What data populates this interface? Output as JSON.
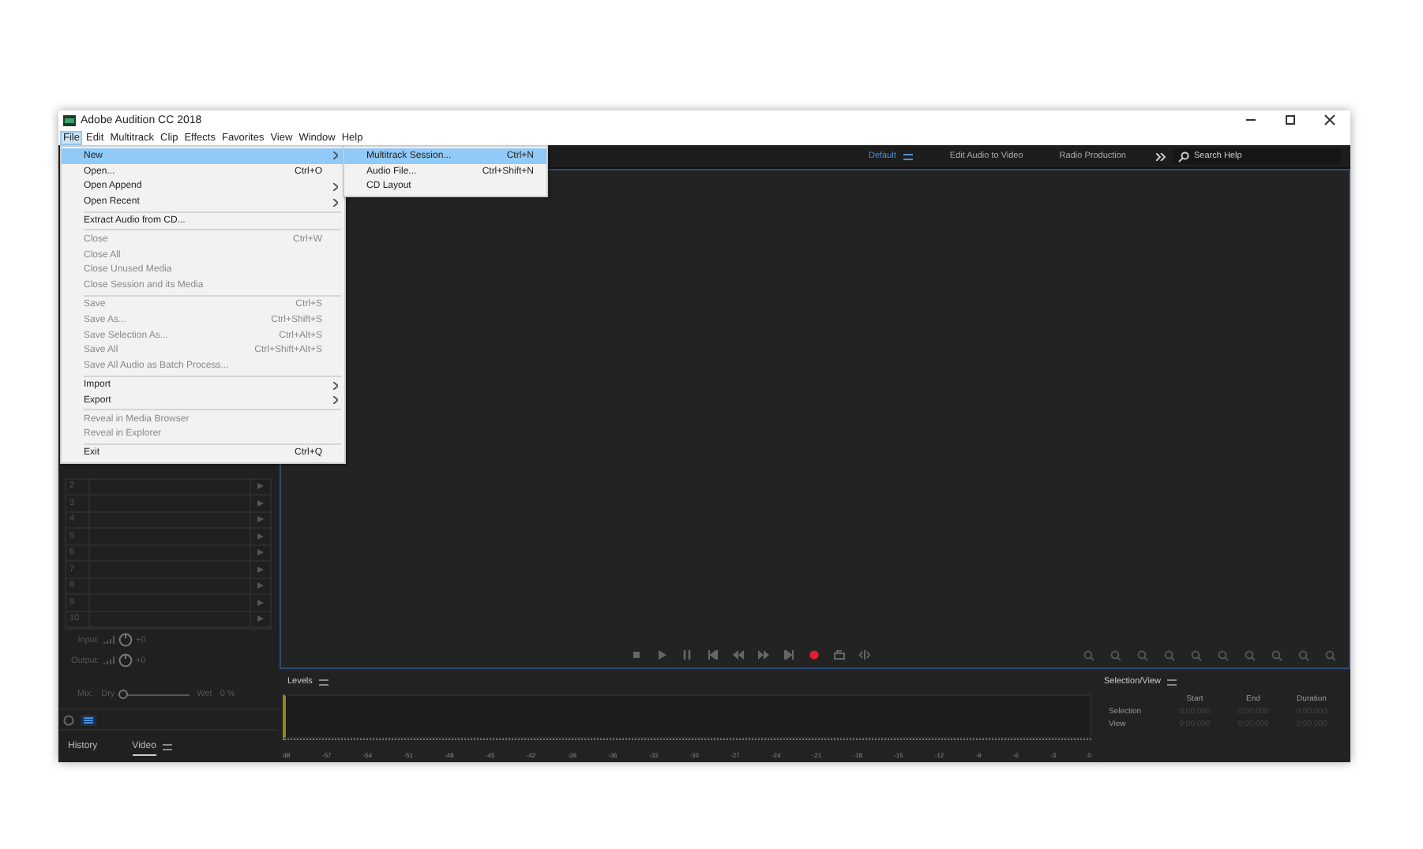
{
  "window": {
    "title": "Adobe Audition CC 2018"
  },
  "menubar": [
    {
      "label": "File",
      "selected": true
    },
    {
      "label": "Edit",
      "selected": false
    },
    {
      "label": "Multitrack",
      "selected": false
    },
    {
      "label": "Clip",
      "selected": false
    },
    {
      "label": "Effects",
      "selected": false
    },
    {
      "label": "Favorites",
      "selected": false
    },
    {
      "label": "View",
      "selected": false
    },
    {
      "label": "Window",
      "selected": false
    },
    {
      "label": "Help",
      "selected": false
    }
  ],
  "file_menu": [
    [
      {
        "label": "New",
        "submenu": true,
        "disabled": false,
        "selected": true
      },
      {
        "label": "Open...",
        "shortcut": "Ctrl+O",
        "submenu": false,
        "disabled": false,
        "selected": false
      },
      {
        "label": "Open Append",
        "submenu": true,
        "disabled": false,
        "selected": false
      },
      {
        "label": "Open Recent",
        "submenu": true,
        "disabled": false,
        "selected": false
      }
    ],
    [
      {
        "label": "Extract Audio from CD...",
        "submenu": false,
        "disabled": false,
        "selected": false
      }
    ],
    [
      {
        "label": "Close",
        "shortcut": "Ctrl+W",
        "submenu": false,
        "disabled": true,
        "selected": false
      },
      {
        "label": "Close All",
        "submenu": false,
        "disabled": true,
        "selected": false
      },
      {
        "label": "Close Unused Media",
        "submenu": false,
        "disabled": true,
        "selected": false
      },
      {
        "label": "Close Session and its Media",
        "submenu": false,
        "disabled": true,
        "selected": false
      }
    ],
    [
      {
        "label": "Save",
        "shortcut": "Ctrl+S",
        "submenu": false,
        "disabled": true,
        "selected": false
      },
      {
        "label": "Save As...",
        "shortcut": "Ctrl+Shift+S",
        "submenu": false,
        "disabled": true,
        "selected": false
      },
      {
        "label": "Save Selection As...",
        "shortcut": "Ctrl+Alt+S",
        "submenu": false,
        "disabled": true,
        "selected": false
      },
      {
        "label": "Save All",
        "shortcut": "Ctrl+Shift+Alt+S",
        "submenu": false,
        "disabled": true,
        "selected": false
      },
      {
        "label": "Save All Audio as Batch Process...",
        "submenu": false,
        "disabled": true,
        "selected": false
      }
    ],
    [
      {
        "label": "Import",
        "submenu": true,
        "disabled": false,
        "selected": false
      },
      {
        "label": "Export",
        "submenu": true,
        "disabled": false,
        "selected": false
      }
    ],
    [
      {
        "label": "Reveal in Media Browser",
        "submenu": false,
        "disabled": true,
        "selected": false
      },
      {
        "label": "Reveal in Explorer",
        "submenu": false,
        "disabled": true,
        "selected": false
      }
    ],
    [
      {
        "label": "Exit",
        "shortcut": "Ctrl+Q",
        "submenu": false,
        "disabled": false,
        "selected": false
      }
    ]
  ],
  "new_submenu": [
    {
      "label": "Multitrack Session...",
      "shortcut": "Ctrl+N",
      "selected": true
    },
    {
      "label": "Audio File...",
      "shortcut": "Ctrl+Shift+N",
      "selected": false
    },
    {
      "label": "CD Layout",
      "selected": false
    }
  ],
  "workspaces": [
    {
      "label": "Default",
      "selected": true
    },
    {
      "label": "Edit Audio to Video",
      "selected": false
    },
    {
      "label": "Radio Production",
      "selected": false
    }
  ],
  "search": {
    "placeholder": "Search Help"
  },
  "effects_rack": {
    "rows": [
      "2",
      "3",
      "4",
      "5",
      "6",
      "7",
      "8",
      "9",
      "10"
    ],
    "input_label": "Input:",
    "input_value": "+0",
    "output_label": "Output:",
    "output_value": "+0",
    "mix_label": "Mix:",
    "dry_label": "Dry",
    "wet_label": "Wet",
    "mix_value": "0 %",
    "level": 0
  },
  "panel_tabs": [
    {
      "label": "History",
      "selected": false
    },
    {
      "label": "Video",
      "selected": true
    }
  ],
  "levels": {
    "title": "Levels",
    "scale": [
      "dB",
      "-57",
      "-54",
      "-51",
      "-48",
      "-45",
      "-42",
      "-39",
      "-36",
      "-33",
      "-30",
      "-27",
      "-24",
      "-21",
      "-18",
      "-15",
      "-12",
      "-9",
      "-6",
      "-3",
      "0"
    ]
  },
  "selection_view": {
    "title": "Selection/View",
    "columns": [
      "Start",
      "End",
      "Duration"
    ],
    "rows": [
      {
        "label": "Selection",
        "values": [
          "0:00.000",
          "0:00.000",
          "0:00.000"
        ]
      },
      {
        "label": "View",
        "values": [
          "0:00.000",
          "0:00.000",
          "0:00.000"
        ]
      }
    ]
  }
}
